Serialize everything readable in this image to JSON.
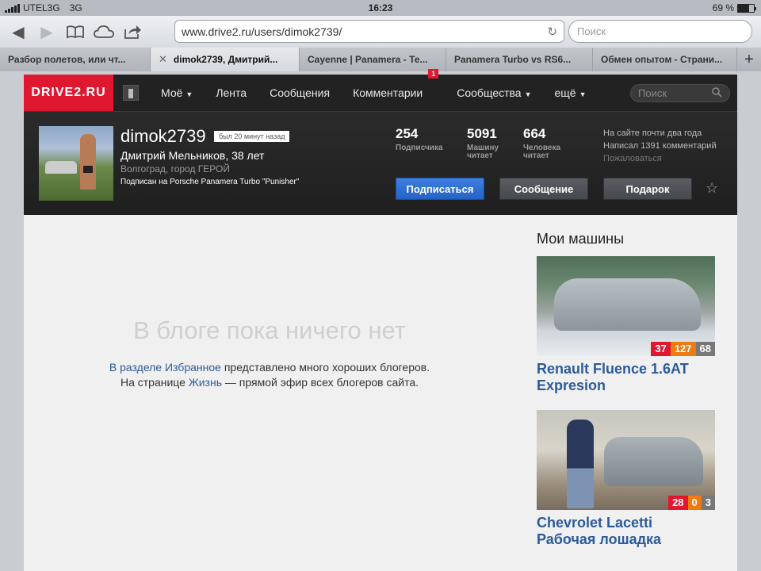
{
  "statusbar": {
    "carrier": "UTEL3G",
    "network": "3G",
    "time": "16:23",
    "battery": "69 %",
    "battery_level": 0.69
  },
  "browser": {
    "url": "www.drive2.ru/users/dimok2739/",
    "search_placeholder": "Поиск",
    "tabs": [
      {
        "label": "Разбор полетов, или чт...",
        "active": false
      },
      {
        "label": "dimok2739, Дмитрий...",
        "active": true
      },
      {
        "label": "Cayenne | Panamera - Те...",
        "active": false
      },
      {
        "label": "Panamera Turbo vs RS6...",
        "active": false
      },
      {
        "label": "Обмен опытом - Страни...",
        "active": false
      }
    ],
    "new_tab": "+"
  },
  "site": {
    "logo": "DRIVE2.RU",
    "nav": [
      {
        "label": "Моё",
        "caret": true
      },
      {
        "label": "Лента",
        "caret": false
      },
      {
        "label": "Сообщения",
        "caret": false
      },
      {
        "label": "Комментарии",
        "caret": false,
        "badge": "1"
      },
      {
        "label": "Сообщества",
        "caret": true
      },
      {
        "label": "ещё",
        "caret": true
      }
    ],
    "search_placeholder": "Поиск"
  },
  "profile": {
    "username": "dimok2739",
    "last_seen": "был 20 минут назад",
    "full_name": "Дмитрий Мельников, 38 лет",
    "city": "Волгоград, город ГЕРОЙ",
    "subscribed": "Подписан на Porsche Panamera Turbo \"Punisher\"",
    "stats": [
      {
        "num": "254",
        "label1": "Подписчика",
        "label2": ""
      },
      {
        "num": "5091",
        "label1": "Машину",
        "label2": "читает"
      },
      {
        "num": "664",
        "label1": "Человека",
        "label2": "читает"
      }
    ],
    "info": [
      "На сайте почти два года",
      "Написал 1391 комментарий"
    ],
    "complain": "Пожаловаться",
    "buttons": {
      "subscribe": "Подписаться",
      "message": "Сообщение",
      "gift": "Подарок"
    },
    "star": "☆"
  },
  "blog": {
    "empty_title": "В блоге пока ничего нет",
    "line1_link": "В разделе Избранное",
    "line1_rest": " представлено много хороших блогеров.",
    "line2_pre": "На странице ",
    "line2_link": "Жизнь",
    "line2_rest": " — прямой эфир всех блогеров сайта."
  },
  "cars": {
    "title": "Мои машины",
    "items": [
      {
        "name": "Renault Fluence 1.6AT Expresion",
        "scores": [
          "37",
          "127",
          "68"
        ]
      },
      {
        "name": "Chevrolet Lacetti Рабочая лошадка",
        "scores": [
          "28",
          "0",
          "3"
        ]
      }
    ]
  },
  "colors": {
    "brand_red": "#e0182f",
    "link_blue": "#2b5a9b",
    "primary_blue": "#2f6fd6",
    "score_orange": "#f07a12"
  }
}
